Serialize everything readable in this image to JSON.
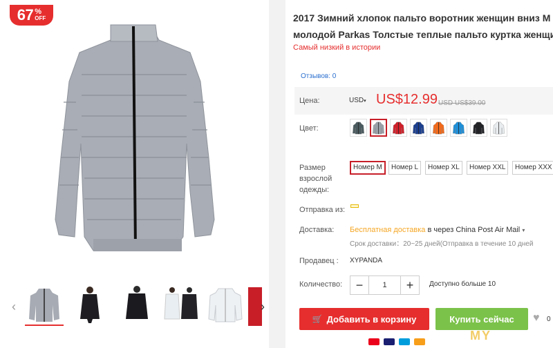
{
  "badge": {
    "number": "67",
    "percent": "%",
    "off": "OFF"
  },
  "product": {
    "title_line1": "2017 Зимний хлопок пальто воротник женщин вниз М",
    "title_line2": "молодой Parkas Толстые теплые пальто куртка женщи",
    "subtitle": "Самый низкий в истории",
    "reviews": "Отзывов: 0"
  },
  "price": {
    "label": "Цена:",
    "currency": "USD",
    "currency_caret": "▾",
    "current": "US$12.99",
    "old": "USD US$39.00"
  },
  "color": {
    "label": "Цвет:",
    "swatches": [
      {
        "name": "dark-jacket",
        "color": "#4a5a5e",
        "active": false
      },
      {
        "name": "gray-jacket",
        "color": "#9aa0a8",
        "active": true
      },
      {
        "name": "red-jacket",
        "color": "#d0202a",
        "active": false
      },
      {
        "name": "navy-jacket",
        "color": "#1c3f8e",
        "active": false
      },
      {
        "name": "orange-jacket",
        "color": "#f26a1b",
        "active": false
      },
      {
        "name": "blue-jacket",
        "color": "#1f8fd8",
        "active": false
      },
      {
        "name": "black-jacket",
        "color": "#222428",
        "active": false
      },
      {
        "name": "white-jacket",
        "color": "#e8ecef",
        "active": false
      }
    ]
  },
  "size": {
    "label_line1": "Размер",
    "label_line2": "взрослой",
    "label_line3": "одежды:",
    "options": [
      "Номер M",
      "Номер L",
      "Номер XL",
      "Номер XXL",
      "Номер XXX"
    ]
  },
  "shipping": {
    "from_label": "Отправка из:",
    "delivery_label": "Доставка:",
    "free": "Бесплатная доставка",
    "via": " в через China Post Air Mail",
    "via_caret": "▾",
    "time": "Срок доставки：20~25 дней(Отправка в течение 10 дней"
  },
  "seller": {
    "label": "Продавец :",
    "name": "XYPANDA"
  },
  "quantity": {
    "label": "Количество:",
    "minus": "−",
    "value": "1",
    "plus": "+",
    "available": "Доступно больше 10"
  },
  "actions": {
    "cart_icon": "🛒",
    "add_to_cart": "Добавить в корзину",
    "buy_now": "Купить сейчас",
    "wishlist_icon": "♥",
    "wishlist_count": "0"
  },
  "watermark": "MY"
}
